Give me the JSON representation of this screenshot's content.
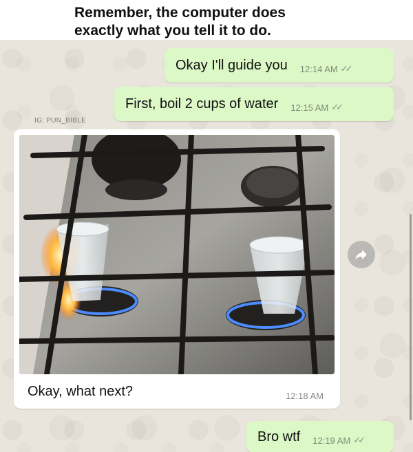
{
  "caption": {
    "line1": "Remember, the computer does",
    "line2": "exactly what you tell it to do."
  },
  "messages": [
    {
      "text": "Okay I'll guide you",
      "time": "12:14 AM",
      "direction": "outgoing",
      "ticks": "read"
    },
    {
      "text": "First, boil 2 cups of water",
      "time": "12:15 AM",
      "direction": "outgoing",
      "ticks": "read"
    },
    {
      "text": "Okay, what next?",
      "time": "12:18 AM",
      "direction": "incoming",
      "has_photo": true
    },
    {
      "text": "Bro wtf",
      "time": "12:19 AM",
      "direction": "outgoing",
      "ticks": "read"
    }
  ],
  "watermark": "IG: PUN_BIBLE",
  "icons": {
    "forward": "forward-arrow-icon",
    "ticks": "double-check-icon"
  },
  "colors": {
    "outgoing_bubble": "#dcf8c6",
    "incoming_bubble": "#ffffff",
    "chat_background": "#e9e4dc"
  }
}
